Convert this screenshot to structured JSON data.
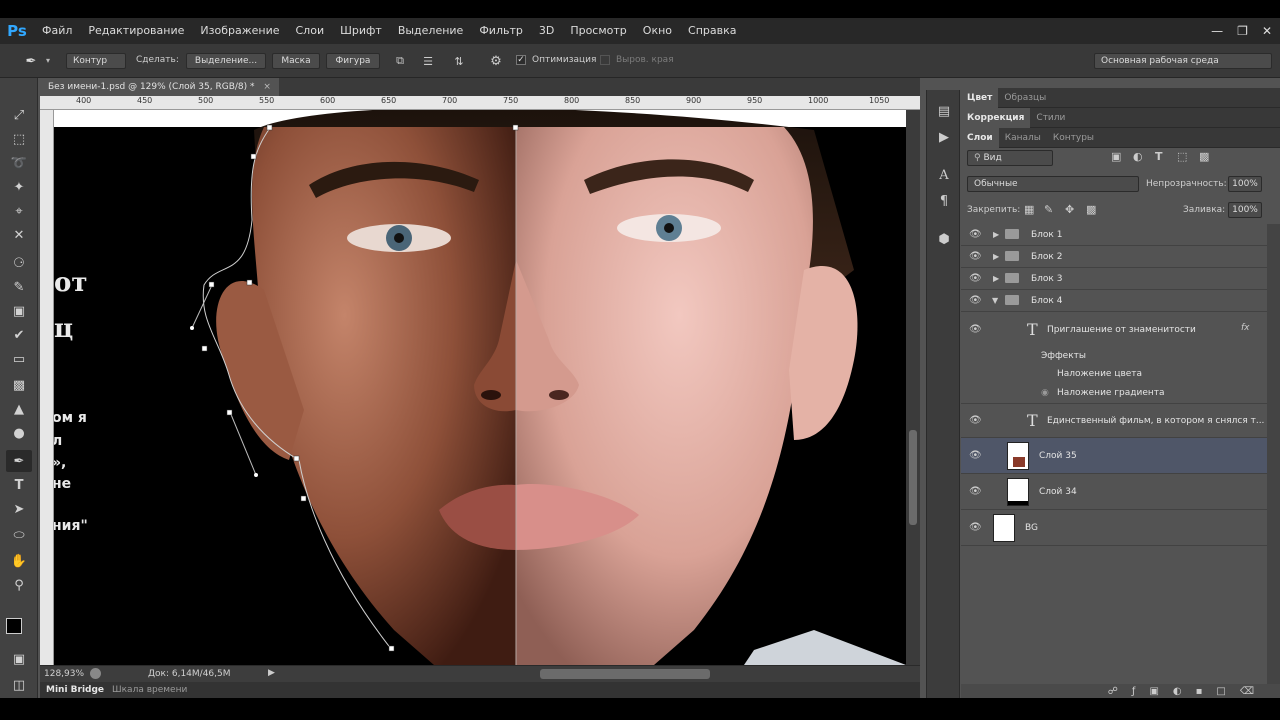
{
  "app": {
    "logo": "Ps"
  },
  "menu": [
    "Файл",
    "Редактирование",
    "Изображение",
    "Слои",
    "Шрифт",
    "Выделение",
    "Фильтр",
    "3D",
    "Просмотр",
    "Окно",
    "Справка"
  ],
  "options": {
    "mode": "Контур",
    "make_label": "Сделать:",
    "selection_btn": "Выделение...",
    "mask_btn": "Маска",
    "shape_btn": "Фигура",
    "optimization_label": "Оптимизация",
    "edges_label": "Выров. края",
    "workspace": "Основная рабочая среда"
  },
  "document": {
    "tab_title": "Без имени-1.psd @ 129% (Слой 35, RGB/8) *",
    "ruler_ticks": [
      "400",
      "450",
      "500",
      "550",
      "600",
      "650",
      "700",
      "750",
      "800",
      "850",
      "900",
      "950",
      "1000",
      "1050"
    ],
    "overlay_lines": [
      "от",
      "ц",
      "ом я",
      "л",
      "»,",
      "не",
      "ния\""
    ]
  },
  "status": {
    "zoom": "128,93%",
    "doc_info": "Док: 6,14M/46,5M"
  },
  "bottom_tabs": [
    "Mini Bridge",
    "Шкала времени"
  ],
  "panels": {
    "color_tabs": [
      "Цвет",
      "Образцы"
    ],
    "adjust_tabs": [
      "Коррекция",
      "Стили"
    ],
    "layer_tabs": [
      "Слои",
      "Каналы",
      "Контуры"
    ],
    "filter_kind": "Вид",
    "blend_mode": "Обычные",
    "opacity_label": "Непрозрачность:",
    "opacity_value": "100%",
    "lock_label": "Закрепить:",
    "fill_label": "Заливка:",
    "fill_value": "100%"
  },
  "layers": [
    {
      "name": "Блок 1",
      "kind": "group"
    },
    {
      "name": "Блок 2",
      "kind": "group"
    },
    {
      "name": "Блок 3",
      "kind": "group"
    },
    {
      "name": "Блок 4",
      "kind": "group-open"
    },
    {
      "name": "Приглашение от знаменитости",
      "kind": "text",
      "fx": "fx"
    },
    {
      "name": "Эффекты",
      "kind": "effects-header"
    },
    {
      "name": "Наложение цвета",
      "kind": "effect"
    },
    {
      "name": "Наложение градиента",
      "kind": "effect"
    },
    {
      "name": "Единственный фильм, в котором я снялся т...",
      "kind": "text"
    },
    {
      "name": "Слой 35",
      "kind": "pixel",
      "selected": true
    },
    {
      "name": "Слой 34",
      "kind": "pixel"
    },
    {
      "name": "BG",
      "kind": "fill"
    }
  ],
  "colors": {
    "accent": "#31a8ff",
    "selected_layer": "#4f5668"
  }
}
